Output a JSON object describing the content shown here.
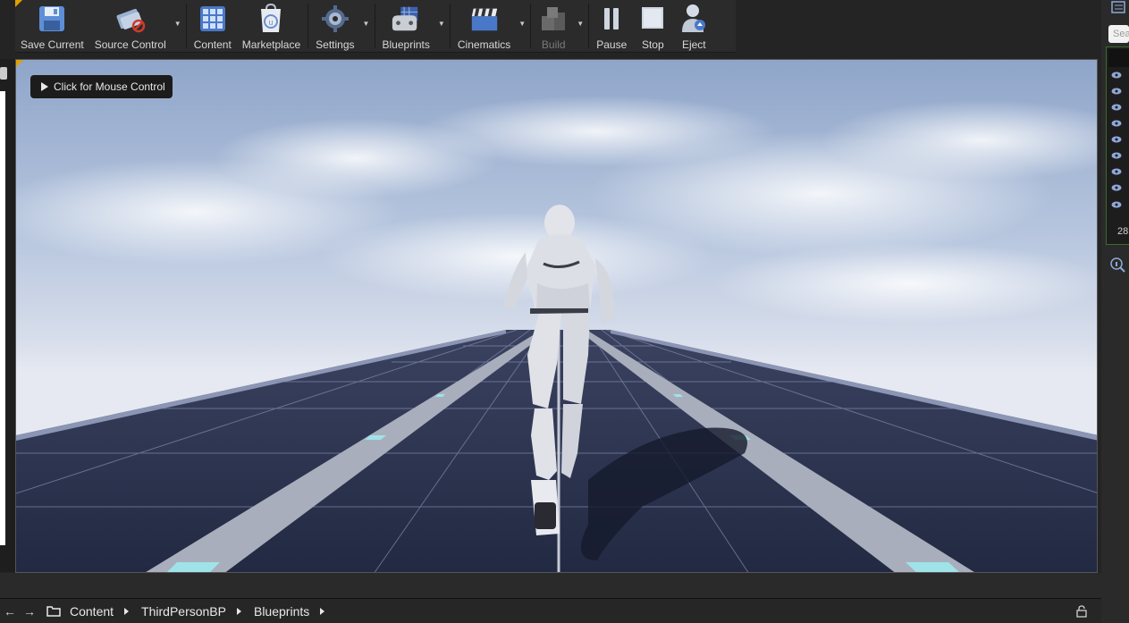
{
  "toolbar": {
    "save_current": "Save Current",
    "source_control": "Source Control",
    "content": "Content",
    "marketplace": "Marketplace",
    "settings": "Settings",
    "blueprints": "Blueprints",
    "cinematics": "Cinematics",
    "build": "Build",
    "pause": "Pause",
    "stop": "Stop",
    "eject": "Eject"
  },
  "viewport": {
    "mouse_hint": "Click for Mouse Control"
  },
  "outliner": {
    "search_placeholder": "Sea",
    "count": "28"
  },
  "content_browser": {
    "path": [
      "Content",
      "ThirdPersonBP",
      "Blueprints"
    ]
  },
  "colors": {
    "accent_orange": "#e0a000",
    "floor_navy": "#272e47",
    "lane_gray": "#a9aebd",
    "lane_light_cyan": "#9fe3e8"
  },
  "icons": {
    "save": "floppy-disk-icon",
    "source_control": "source-control-icon",
    "content": "content-grid-icon",
    "marketplace": "marketplace-icon",
    "settings": "settings-gear-icon",
    "blueprints": "blueprints-controller-icon",
    "cinematics": "clapperboard-icon",
    "build": "build-blocks-icon",
    "pause": "pause-icon",
    "stop": "stop-icon",
    "eject": "eject-person-icon"
  }
}
